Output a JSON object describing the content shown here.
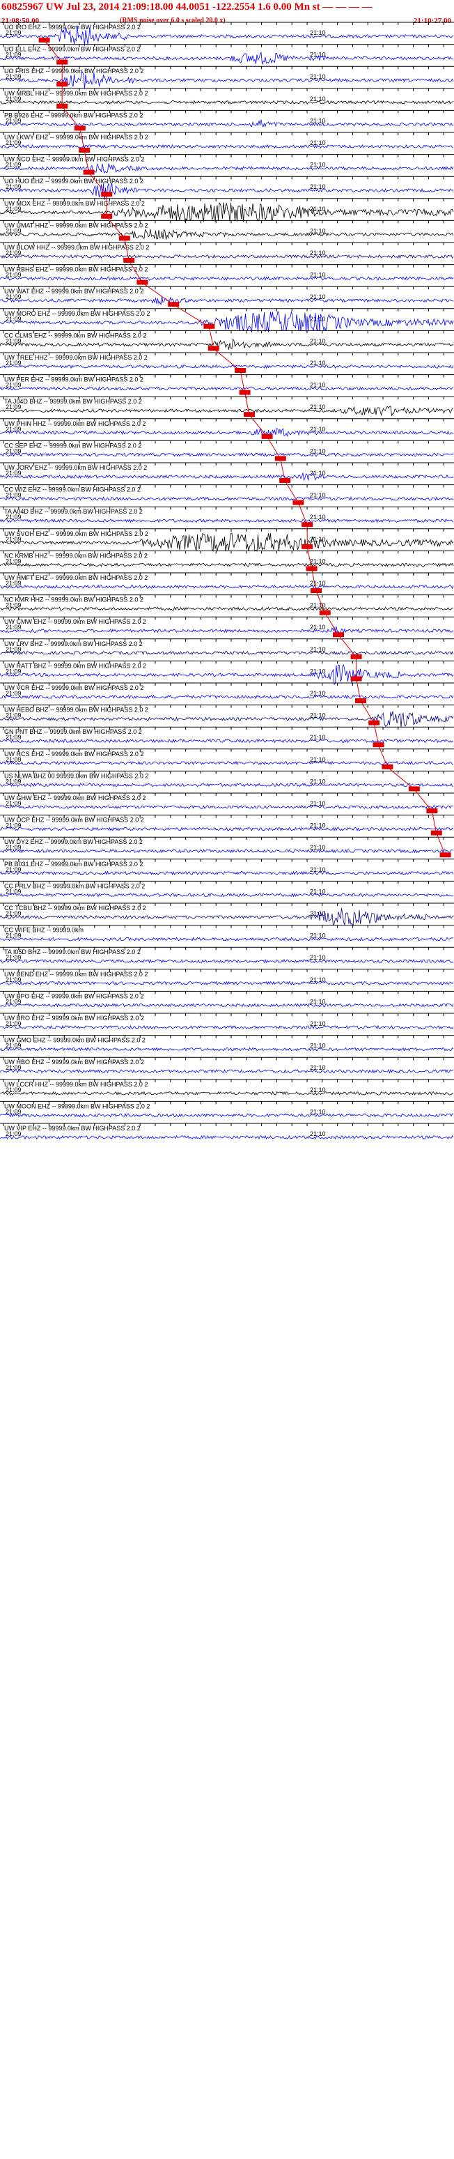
{
  "header": {
    "title": "60825967 UW Jul 23, 2014 21:09:18.00   44.0051  -122.2554  1.6 0.00 Mn st — — — —",
    "start_time": "21:08:50.00",
    "noise_note": "(RMS noise over 6.0 s scaled 20.0 x)",
    "end_time": "21:10:27.00"
  },
  "chart_data": {
    "type": "line",
    "minute_labels": [
      "21:09",
      "21:10"
    ],
    "traces": [
      {
        "label": "UO IRO EHZ -- 99999.0km BW  HIGHPASS  2.0  2",
        "color": "#0000ff",
        "pick_frac": 0.09,
        "burst": [
          0.12,
          0.28,
          1.0
        ]
      },
      {
        "label": "UO ELL EHZ -- 99999.0km BW  HIGHPASS  2.0  2",
        "color": "#0000ff",
        "pick_frac": 0.13,
        "burst": [
          0.5,
          0.72,
          0.5
        ]
      },
      {
        "label": "UO FRIS EHZ -- 99999.0km BW  HIGHPASS  2.0  2",
        "color": "#0000ff",
        "pick_frac": 0.13,
        "burst": [
          0.14,
          0.3,
          0.8
        ]
      },
      {
        "label": "UW MRBL HHZ -- 99999.0km BW  HIGHPASS  2.0  2",
        "color": "#000000",
        "pick_frac": 0.13,
        "burst": null
      },
      {
        "label": "PB B926 EHZ -- 99999.0km BW  HIGHPASS  2.0  2",
        "color": "#0000ff",
        "pick_frac": 0.17,
        "burst": [
          0.55,
          0.62,
          0.35
        ]
      },
      {
        "label": "UW LKWY EHZ -- 99999.0km BW  HIGHPASS  2.0  2",
        "color": "#0000ff",
        "pick_frac": 0.18,
        "burst": null
      },
      {
        "label": "UW NCO EHZ -- 99999.0km BW  HIGHPASS  2.0  2",
        "color": "#0000ff",
        "pick_frac": 0.19,
        "burst": [
          0.19,
          0.32,
          0.35
        ]
      },
      {
        "label": "UO HUO EHZ -- 99999.0km BW  HIGHPASS  2.0  2",
        "color": "#0000ff",
        "pick_frac": 0.23,
        "burst": [
          0.2,
          0.3,
          0.9
        ]
      },
      {
        "label": "UW MOX EHZ -- 99999.0km BW  HIGHPASS  2.0  2",
        "color": "#000000",
        "pick_frac": 0.23,
        "burst": [
          0.25,
          1.0,
          0.9
        ]
      },
      {
        "label": "UW UMAT HHZ -- 99999.0km BW  HIGHPASS  2.0  2",
        "color": "#000000",
        "pick_frac": 0.27,
        "burst": [
          0.27,
          0.5,
          0.4
        ]
      },
      {
        "label": "UW BLOW HHZ -- 99999.0km BW  HIGHPASS  2.0  2",
        "color": "#000080",
        "pick_frac": 0.28,
        "burst": null
      },
      {
        "label": "UW RBHS EHZ -- 99999.0km BW  HIGHPASS  2.0  2",
        "color": "#0000ff",
        "pick_frac": 0.31,
        "burst": null
      },
      {
        "label": "UW WAT EHZ -- 99999.0km BW  HIGHPASS  2.0  2",
        "color": "#0000ff",
        "pick_frac": 0.38,
        "burst": [
          0.33,
          0.42,
          0.3
        ]
      },
      {
        "label": "UW MORO EHZ -- 99999.0km BW  HIGHPASS  2.0  2",
        "color": "#0000ff",
        "pick_frac": 0.46,
        "burst": [
          0.44,
          1.0,
          1.0
        ]
      },
      {
        "label": "CC CLMS EHZ -- 99999.0km BW  HIGHPASS  2.0  2",
        "color": "#000000",
        "pick_frac": 0.47,
        "burst": [
          0.47,
          0.6,
          0.5
        ]
      },
      {
        "label": "UW TREE HHZ -- 99999.0km BW  HIGHPASS  2.0  2",
        "color": "#0000ff",
        "pick_frac": 0.53,
        "burst": null
      },
      {
        "label": "UW PER EHZ -- 99999.0km BW  HIGHPASS  2.0  2",
        "color": "#0000ff",
        "pick_frac": 0.54,
        "burst": null
      },
      {
        "label": "TA J04D BHZ -- 99999.0km BW  HIGHPASS  2.0  2",
        "color": "#000000",
        "pick_frac": 0.55,
        "burst": [
          0.75,
          1.0,
          0.4
        ]
      },
      {
        "label": "UW PHIN HHZ -- 99999.0km BW  HIGHPASS  2.0  2",
        "color": "#0000ff",
        "pick_frac": 0.59,
        "burst": [
          0.55,
          0.7,
          0.35
        ]
      },
      {
        "label": "CC SEP EHZ -- 99999.0km BW  HIGHPASS  2.0  2",
        "color": "#0000ff",
        "pick_frac": 0.62,
        "burst": null
      },
      {
        "label": "UW JORV EHZ -- 99999.0km BW  HIGHPASS  2.0  2",
        "color": "#0000ff",
        "pick_frac": 0.63,
        "burst": [
          0.66,
          0.72,
          0.4
        ]
      },
      {
        "label": "CC WIZ EHZ -- 99999.0km BW  HIGHPASS  2.0  2",
        "color": "#0000ff",
        "pick_frac": 0.66,
        "burst": null
      },
      {
        "label": "TA A04D BHZ -- 99999.0km BW  HIGHPASS  2.0  2",
        "color": "#0000ff",
        "pick_frac": 0.68,
        "burst": null
      },
      {
        "label": "UW SVOH EHZ -- 99999.0km BW  HIGHPASS  2.0  2",
        "color": "#000000",
        "pick_frac": 0.68,
        "burst": [
          0.3,
          1.0,
          0.9
        ]
      },
      {
        "label": "NC KRMB HHZ -- 99999.0km BW  HIGHPASS  2.0  2",
        "color": "#000000",
        "pick_frac": 0.69,
        "burst": null
      },
      {
        "label": "UW HMFT EHZ -- 99999.0km BW  HIGHPASS  2.0  2",
        "color": "#0000ff",
        "pick_frac": 0.7,
        "burst": null
      },
      {
        "label": "NC KMR HHZ -- 99999.0km BW  HIGHPASS  2.0  2",
        "color": "#000000",
        "pick_frac": 0.72,
        "burst": null
      },
      {
        "label": "UW CMW EHZ -- 99999.0km BW  HIGHPASS  2.0  2",
        "color": "#0000ff",
        "pick_frac": 0.75,
        "burst": [
          0.73,
          0.76,
          0.6
        ]
      },
      {
        "label": "UW LRV BHZ -- 99999.0km BW  HIGHPASS  2.0  2",
        "color": "#000080",
        "pick_frac": 0.79,
        "burst": null
      },
      {
        "label": "UW RATT BHZ -- 99999.0km BW  HIGHPASS  2.0  2",
        "color": "#0000ff",
        "pick_frac": 0.79,
        "burst": [
          0.69,
          0.88,
          0.9
        ]
      },
      {
        "label": "UW VCR EHZ -- 99999.0km BW  HIGHPASS  2.0  2",
        "color": "#0000ff",
        "pick_frac": 0.8,
        "burst": null
      },
      {
        "label": "UW HEBO BHZ -- 99999.0km BW  HIGHPASS  2.0  2",
        "color": "#000080",
        "pick_frac": 0.83,
        "burst": [
          0.82,
          1.0,
          0.8
        ]
      },
      {
        "label": "GN PNT BHZ -- 99999.0km BW  HIGHPASS  2.0  2",
        "color": "#0000ff",
        "pick_frac": 0.84,
        "burst": null
      },
      {
        "label": "UW RCS EHZ -- 99999.0km BW  HIGHPASS  2.0  2",
        "color": "#0000ff",
        "pick_frac": 0.86,
        "burst": null
      },
      {
        "label": "US NLWA BHZ 00 99999.0km BW  HIGHPASS  2.0  2",
        "color": "#0000ff",
        "pick_frac": 0.92,
        "burst": null
      },
      {
        "label": "UW GHW EHZ -- 99999.0km BW  HIGHPASS  2.0  2",
        "color": "#0000ff",
        "pick_frac": 0.96,
        "burst": null
      },
      {
        "label": "UW OCP EHZ -- 99999.0km BW  HIGHPASS  2.0  2",
        "color": "#0000ff",
        "pick_frac": 0.97,
        "burst": null
      },
      {
        "label": "UW DY2 EHZ -- 99999.0km BW  HIGHPASS  2.0  2",
        "color": "#0000ff",
        "pick_frac": 0.99,
        "burst": null
      },
      {
        "label": "PB B031 EHZ -- 99999.0km BW  HIGHPASS  2.0  2",
        "color": "#0000ff",
        "pick_frac": null,
        "burst": null
      },
      {
        "label": "CC PRLV BHZ -- 99999.0km BW  HIGHPASS  2.0  2",
        "color": "#0000ff",
        "pick_frac": null,
        "burst": null
      },
      {
        "label": "CC TCBU BHZ -- 99999.0km BW  HIGHPASS  2.0  2",
        "color": "#000080",
        "pick_frac": null,
        "burst": [
          0.68,
          0.95,
          0.8
        ]
      },
      {
        "label": "CC WIFE BHZ -- 99999.0km",
        "color": "#0000ff",
        "pick_frac": null,
        "burst": null
      },
      {
        "label": "TA I05D BHZ -- 99999.0km BW  HIGHPASS  2.0  2",
        "color": "#0000ff",
        "pick_frac": null,
        "burst": null
      },
      {
        "label": "UW BEND EHZ -- 99999.0km BW  HIGHPASS  2.0  2",
        "color": "#0000ff",
        "pick_frac": null,
        "burst": null
      },
      {
        "label": "UW BPO EHZ -- 99999.0km BW  HIGHPASS  2.0  2",
        "color": "#0000ff",
        "pick_frac": null,
        "burst": null
      },
      {
        "label": "UW BRO EHZ -- 99999.0km BW  HIGHPASS  2.0  2",
        "color": "#0000ff",
        "pick_frac": null,
        "burst": null
      },
      {
        "label": "UW GMO EHZ -- 99999.0km BW  HIGHPASS  2.0  2",
        "color": "#0000ff",
        "pick_frac": null,
        "burst": null
      },
      {
        "label": "UW HBO EHZ -- 99999.0km BW  HIGHPASS  2.0  2",
        "color": "#0000ff",
        "pick_frac": null,
        "burst": null
      },
      {
        "label": "UW LCCR HHZ -- 99999.0km BW  HIGHPASS  2.0  2",
        "color": "#000000",
        "pick_frac": null,
        "burst": null
      },
      {
        "label": "UW MOON EHZ -- 99999.0km BW  HIGHPASS  2.0  2",
        "color": "#0000ff",
        "pick_frac": null,
        "burst": null
      },
      {
        "label": "UW VIP EHZ -- 99999.0km BW  HIGHPASS  2.0  2",
        "color": "#0000ff",
        "pick_frac": null,
        "burst": null
      }
    ]
  }
}
